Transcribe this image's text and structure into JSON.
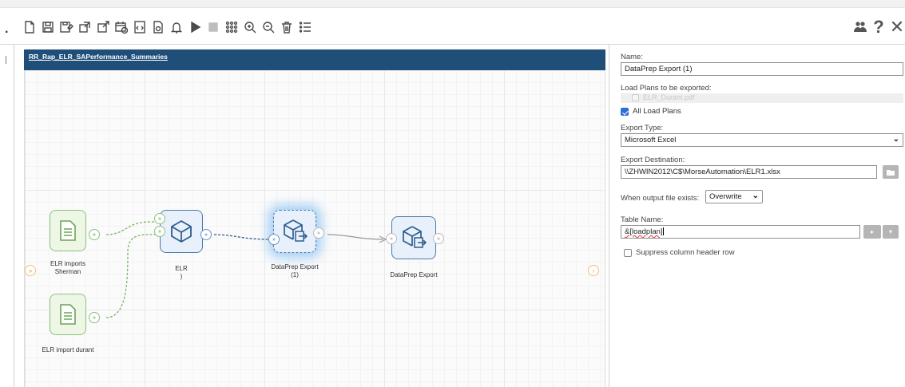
{
  "toolbar": {
    "icons": [
      "new-file-icon",
      "save-icon",
      "save-as-icon",
      "open-external-icon",
      "edit-external-icon",
      "schedule-icon",
      "code-icon",
      "settings-file-icon",
      "notification-bell-icon",
      "run-icon",
      "stop-icon",
      "grid-dots-icon",
      "zoom-in-icon",
      "zoom-out-icon",
      "delete-icon",
      "list-icon"
    ],
    "right_icons": [
      "users-icon",
      "help-icon",
      "close-icon"
    ],
    "help_glyph": "?",
    "close_glyph": "✕"
  },
  "canvas": {
    "title": "RR_Rap_ELR_SAPerformance_Summaries",
    "nodes": [
      {
        "name": "ELR imports Sherman",
        "line1": "ELR imports",
        "line2": "Sherman",
        "kind": "source"
      },
      {
        "name": "ELR import durant",
        "line1": "ELR import durant",
        "line2": "",
        "kind": "source"
      },
      {
        "name": "ELR",
        "line1": "ELR",
        "line2": ")",
        "kind": "transform"
      },
      {
        "name": "DataPrep Export (1)",
        "line1": "DataPrep Export",
        "line2": "(1)",
        "kind": "export",
        "selected": true
      },
      {
        "name": "DataPrep Export",
        "line1": "DataPrep Export",
        "line2": "",
        "kind": "export"
      }
    ]
  },
  "panel": {
    "name_label": "Name:",
    "name_value": "DataPrep Export (1)",
    "load_plans_label": "Load Plans to be exported:",
    "load_plan_item": "ELR_Durant.pdf",
    "all_load_plans_label": "All Load Plans",
    "all_load_plans_checked": true,
    "export_type_label": "Export Type:",
    "export_type_value": "Microsoft Excel",
    "export_dest_label": "Export Destination:",
    "export_dest_value": "\\\\ZHWIN2012\\C$\\MorseAutomation\\ELR1.xlsx",
    "when_exists_label": "When output file exists:",
    "when_exists_value": "Overwrite",
    "table_name_label": "Table Name:",
    "table_name_value": "&[loadplan]",
    "suppress_label": "Suppress column header row",
    "suppress_checked": false
  },
  "colors": {
    "title_bar": "#1f4e79",
    "source_node": "#8cc07a",
    "transform_node": "#4e79aa",
    "selection_glow": "#5aaaf0",
    "checkbox_on": "#2c6fd6"
  }
}
